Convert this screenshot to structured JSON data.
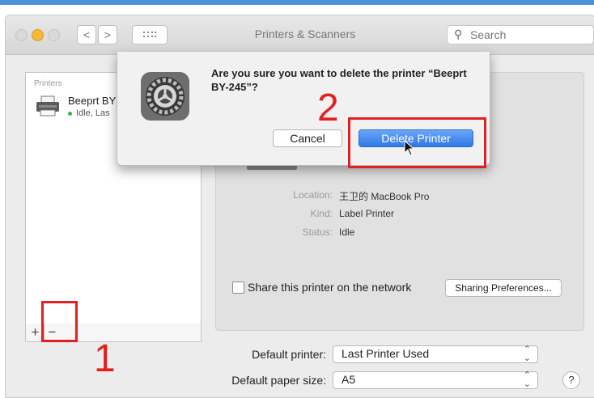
{
  "window": {
    "title": "Printers & Scanners",
    "search_placeholder": "Search",
    "nav": {
      "back": "<",
      "forward": ">",
      "grid": "⋮⋮⋮"
    }
  },
  "sidebar": {
    "header": "Printers",
    "printer": {
      "name": "Beeprt BY",
      "status": "Idle, Las"
    },
    "add_label": "+",
    "remove_label": "−"
  },
  "details": {
    "location_label": "Location:",
    "location_value": "王卫的 MacBook Pro",
    "kind_label": "Kind:",
    "kind_value": "Label Printer",
    "status_label": "Status:",
    "status_value": "Idle",
    "share_label": "Share this printer on the network",
    "sharing_button": "Sharing Preferences..."
  },
  "bottom": {
    "default_printer_label": "Default printer:",
    "default_printer_value": "Last Printer Used",
    "paper_size_label": "Default paper size:",
    "paper_size_value": "A5",
    "help": "?"
  },
  "dialog": {
    "message": "Are you sure you want to delete the printer “Beeprt BY-245”?",
    "cancel_label": "Cancel",
    "delete_label": "Delete Printer"
  },
  "annotations": {
    "step1": "1",
    "step2": "2",
    "color": "#e32020"
  }
}
